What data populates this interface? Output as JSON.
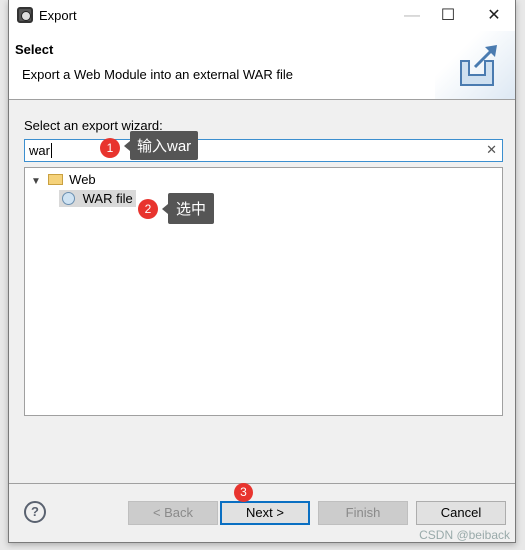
{
  "window": {
    "title": "Export",
    "minimize_icon": "minimize-icon",
    "maximize_icon": "maximize-icon",
    "close_icon": "close-icon"
  },
  "header": {
    "title": "Select",
    "description": "Export a Web Module into an external WAR file",
    "icon": "export-wizard-icon"
  },
  "filter": {
    "label": "Select an export wizard:",
    "value": "war",
    "clear_icon": "clear-icon"
  },
  "tree": {
    "items": [
      {
        "label": "Web",
        "expanded": true,
        "icon": "folder-open-icon"
      },
      {
        "label": "WAR file",
        "selected": true,
        "icon": "war-file-icon"
      }
    ]
  },
  "annotations": [
    {
      "number": "1",
      "text": "输入war"
    },
    {
      "number": "2",
      "text": "选中"
    },
    {
      "number": "3"
    }
  ],
  "buttons": {
    "back": "< Back",
    "next": "Next >",
    "finish": "Finish",
    "cancel": "Cancel"
  },
  "watermark": "CSDN @beiback"
}
